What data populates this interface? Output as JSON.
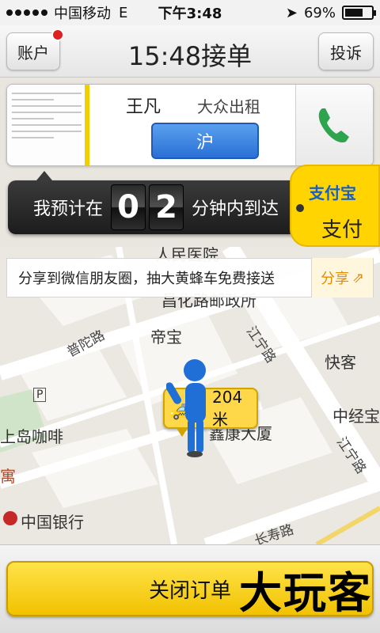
{
  "status_bar": {
    "carrier": "中国移动",
    "network": "E",
    "time": "下午3:48",
    "battery": "69%",
    "battery_level": 0.69
  },
  "header": {
    "account_label": "账户",
    "title": "15:48接单",
    "complaint_label": "投诉"
  },
  "driver": {
    "name": "王凡",
    "company": "大众出租",
    "plate": "沪"
  },
  "eta": {
    "prefix": "我预计在",
    "digit_1": "0",
    "digit_2": "2",
    "suffix": "分钟内到达"
  },
  "alipay": {
    "logo": "支付宝",
    "label": "支付"
  },
  "share_banner": {
    "text": "分享到微信朋友圈，抽大黄蜂车免费接送",
    "button_label": "分享"
  },
  "map": {
    "labels": {
      "hospital": "人民医院",
      "post_office": "昌化路邮政所",
      "dibao": "帝宝",
      "restaurant": "快客",
      "putuo_road": "普陀路",
      "jiangning_road_1": "江宁路",
      "jiangning_road_2": "江宁路",
      "zhongjing": "中经宝",
      "cafe": "上岛咖啡",
      "building": "鑫康大厦",
      "bank": "中国银行",
      "parking": "P",
      "yu": "寓",
      "changshou": "长寿路"
    },
    "distance": "204米"
  },
  "bottom": {
    "close_label": "关闭订单",
    "watermark": "大玩客"
  }
}
